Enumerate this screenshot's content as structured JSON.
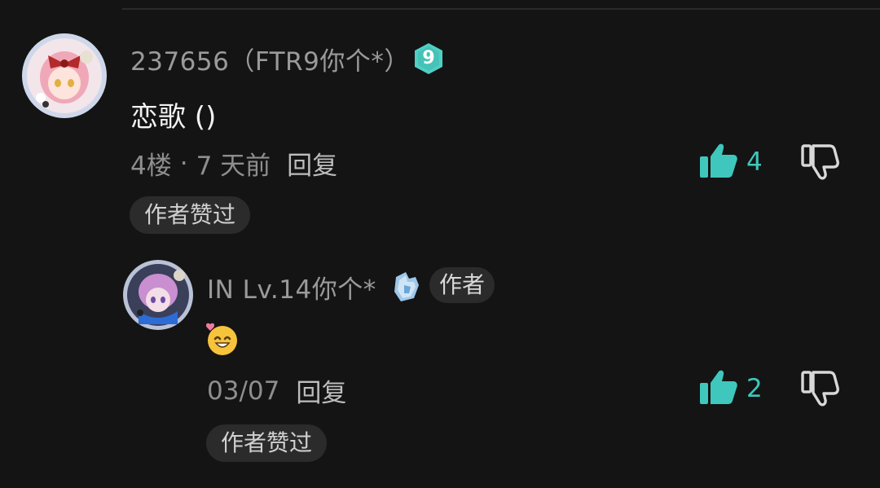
{
  "colors": {
    "background": "#141414",
    "accent_like": "#3fc7bd",
    "level_badge": "#4fd0c4",
    "chip_bg": "#2b2b2b"
  },
  "comment": {
    "username": "237656（FTR9你个*）",
    "level": "9",
    "text": "恋歌 ()",
    "floor": "4楼",
    "separator": "·",
    "time": "7 天前",
    "reply_label": "回复",
    "like_count": "4",
    "author_liked_label": "作者赞过",
    "icons": {
      "avatar": "anime-girl-avatar",
      "level": "level-9-badge-icon",
      "like": "thumbs-up-icon",
      "dislike": "thumbs-down-icon"
    }
  },
  "reply": {
    "username": "IN Lv.14你个*",
    "author_tag": "作者",
    "emoji": "heart-smile-emoji",
    "time": "03/07",
    "reply_label": "回复",
    "like_count": "2",
    "author_liked_label": "作者赞过",
    "icons": {
      "avatar": "anime-boy-avatar",
      "level": "lv14-hand-badge-icon",
      "like": "thumbs-up-icon",
      "dislike": "thumbs-down-icon"
    }
  }
}
